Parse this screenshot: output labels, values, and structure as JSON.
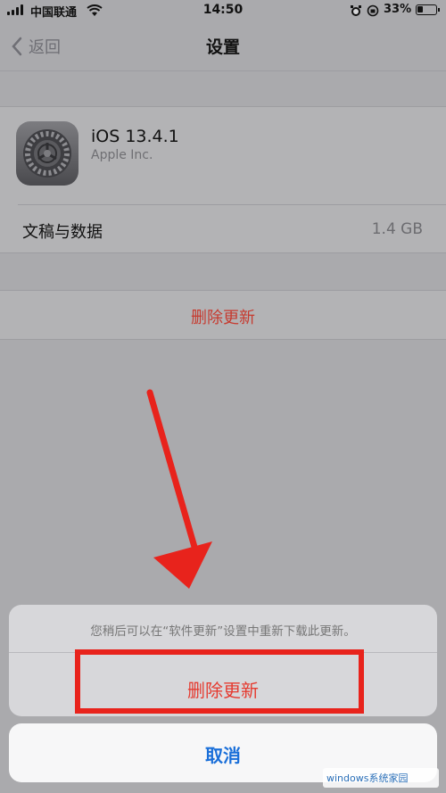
{
  "status_bar": {
    "carrier": "中国联通",
    "time": "14:50",
    "battery_percent": "33%"
  },
  "nav": {
    "back_label": "返回",
    "title": "设置"
  },
  "app": {
    "name": "iOS 13.4.1",
    "developer": "Apple Inc.",
    "icon": "settings-gear-icon"
  },
  "documents": {
    "label": "文稿与数据",
    "value": "1.4 GB"
  },
  "delete_row": {
    "label": "删除更新"
  },
  "action_sheet": {
    "message": "您稍后可以在“软件更新”设置中重新下载此更新。",
    "delete_label": "删除更新",
    "cancel_label": "取消"
  },
  "watermark": {
    "text": "windows系统家园"
  },
  "colors": {
    "destructive": "#e53b30",
    "link": "#1a6fd9",
    "annotation": "#e8231c"
  }
}
